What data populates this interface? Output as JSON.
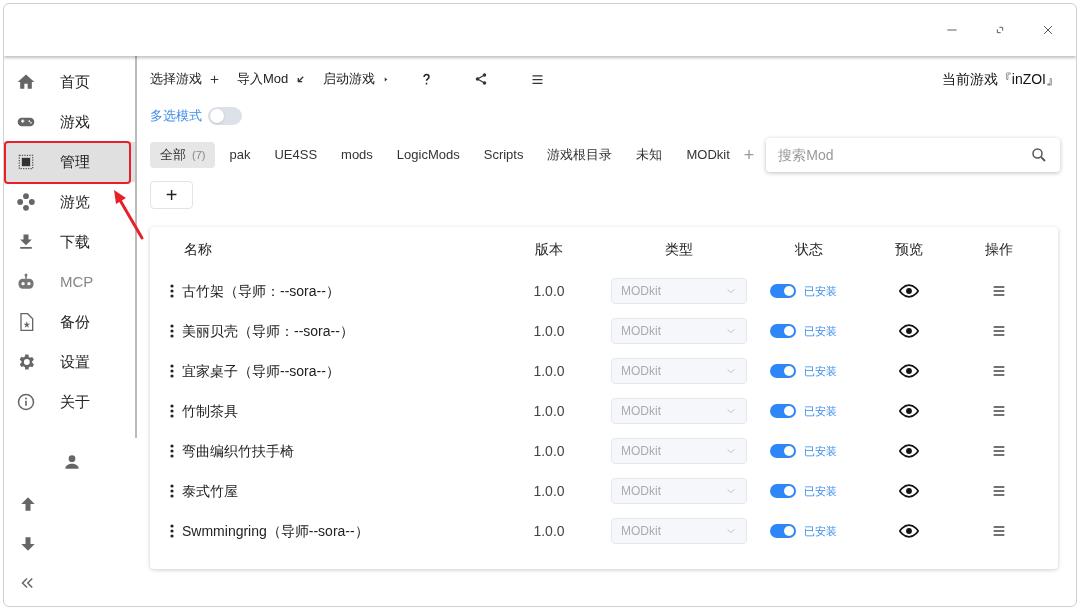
{
  "sidebar": {
    "items": [
      {
        "label": "首页",
        "selected": false,
        "disabled": false
      },
      {
        "label": "游戏",
        "selected": false,
        "disabled": false
      },
      {
        "label": "管理",
        "selected": true,
        "disabled": false
      },
      {
        "label": "游览",
        "selected": false,
        "disabled": false
      },
      {
        "label": "下载",
        "selected": false,
        "disabled": false
      },
      {
        "label": "MCP",
        "selected": false,
        "disabled": true
      },
      {
        "label": "备份",
        "selected": false,
        "disabled": false
      },
      {
        "label": "设置",
        "selected": false,
        "disabled": false
      },
      {
        "label": "关于",
        "selected": false,
        "disabled": false
      }
    ]
  },
  "toolbar": {
    "actions": [
      {
        "label": "选择游戏"
      },
      {
        "label": "导入Mod"
      },
      {
        "label": "启动游戏"
      }
    ],
    "current_game": "当前游戏『inZOI』"
  },
  "multi_select": {
    "label": "多选模式",
    "on": false
  },
  "tabs": [
    {
      "label": "全部",
      "count": "(7)",
      "selected": true
    },
    {
      "label": "pak",
      "selected": false
    },
    {
      "label": "UE4SS",
      "selected": false
    },
    {
      "label": "mods",
      "selected": false
    },
    {
      "label": "LogicMods",
      "selected": false
    },
    {
      "label": "Scripts",
      "selected": false
    },
    {
      "label": "游戏根目录",
      "selected": false
    },
    {
      "label": "未知",
      "selected": false
    },
    {
      "label": "MODkit",
      "selected": false
    }
  ],
  "add_tab": "+",
  "search": {
    "placeholder": "搜索Mod"
  },
  "add_button": "+",
  "table": {
    "columns": [
      "名称",
      "版本",
      "类型",
      "状态",
      "预览",
      "操作"
    ],
    "rows": [
      {
        "name": "古竹架（导师：--sora--）",
        "version": "1.0.0",
        "type": "MODkit",
        "on": true,
        "status": "已安装"
      },
      {
        "name": "美丽贝壳（导师：--sora--）",
        "version": "1.0.0",
        "type": "MODkit",
        "on": true,
        "status": "已安装"
      },
      {
        "name": "宜家桌子（导师--sora--）",
        "version": "1.0.0",
        "type": "MODkit",
        "on": true,
        "status": "已安装"
      },
      {
        "name": "竹制茶具",
        "version": "1.0.0",
        "type": "MODkit",
        "on": true,
        "status": "已安装"
      },
      {
        "name": "弯曲编织竹扶手椅",
        "version": "1.0.0",
        "type": "MODkit",
        "on": true,
        "status": "已安装"
      },
      {
        "name": "泰式竹屋",
        "version": "1.0.0",
        "type": "MODkit",
        "on": true,
        "status": "已安装"
      },
      {
        "name": "Swmmingring（导师--sora--）",
        "version": "1.0.0",
        "type": "MODkit",
        "on": true,
        "status": "已安装"
      }
    ]
  }
}
